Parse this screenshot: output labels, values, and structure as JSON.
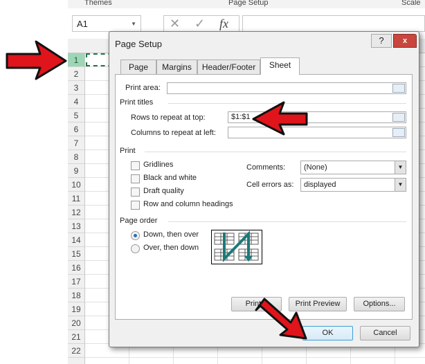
{
  "ribbon": {
    "groups": [
      "Themes",
      "Page Setup",
      "Scale"
    ]
  },
  "formula_bar": {
    "name_box": "A1",
    "cancel_icon": "x-icon",
    "enter_icon": "check-icon",
    "fx": "fx"
  },
  "rows": [
    "1",
    "2",
    "3",
    "4",
    "5",
    "6",
    "7",
    "8",
    "9",
    "10",
    "11",
    "12",
    "13",
    "14",
    "15",
    "16",
    "17",
    "18",
    "19",
    "20",
    "21",
    "22"
  ],
  "dialog": {
    "title": "Page Setup",
    "help": "?",
    "close": "x",
    "tabs": [
      {
        "label": "Page"
      },
      {
        "label": "Margins"
      },
      {
        "label": "Header/Footer"
      },
      {
        "label": "Sheet",
        "active": true
      }
    ],
    "print_area": {
      "label": "Print area:",
      "value": ""
    },
    "print_titles": {
      "label": "Print titles",
      "rows": {
        "label": "Rows to repeat at top:",
        "value": "$1:$1"
      },
      "cols": {
        "label": "Columns to repeat at left:",
        "value": ""
      }
    },
    "print": {
      "label": "Print",
      "checkboxes": [
        {
          "label": "Gridlines",
          "checked": false
        },
        {
          "label": "Black and white",
          "checked": false
        },
        {
          "label": "Draft quality",
          "checked": false
        },
        {
          "label": "Row and column headings",
          "checked": false
        }
      ],
      "comments": {
        "label": "Comments:",
        "value": "(None)"
      },
      "cell_errors": {
        "label": "Cell errors as:",
        "value": "displayed"
      }
    },
    "page_order": {
      "label": "Page order",
      "options": [
        {
          "label": "Down, then over",
          "selected": true
        },
        {
          "label": "Over, then down",
          "selected": false
        }
      ]
    },
    "buttons": {
      "print": "Print...",
      "print_preview": "Print Preview",
      "options": "Options...",
      "ok": "OK",
      "cancel": "Cancel"
    }
  },
  "colors": {
    "arrow": "#e0141b",
    "accent": "#217346",
    "row_selected": "#9fd5b7"
  }
}
